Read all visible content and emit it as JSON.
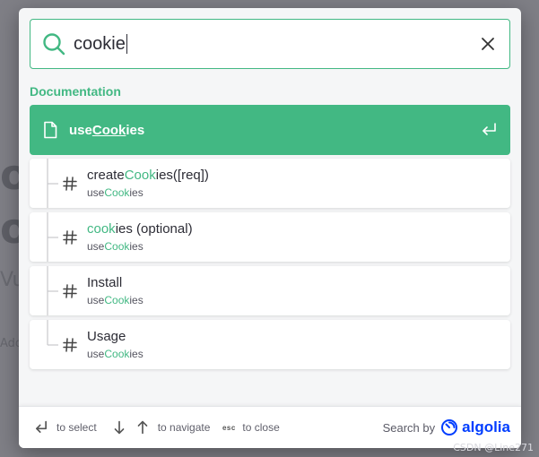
{
  "search": {
    "query": "cookie"
  },
  "section_title": "Documentation",
  "hits": {
    "main": {
      "pre": "use",
      "hl": "Cook",
      "post": "ies"
    },
    "children": [
      {
        "title_pre": "create",
        "title_hl": "Cook",
        "title_post": "ies([req])",
        "sub_pre": "use",
        "sub_hl": "Cook",
        "sub_post": "ies"
      },
      {
        "title_pre": "",
        "title_hl": "cook",
        "title_post": "ies (optional)",
        "sub_pre": "use",
        "sub_hl": "Cook",
        "sub_post": "ies"
      },
      {
        "title_pre": "Install",
        "title_hl": "",
        "title_post": "",
        "sub_pre": "use",
        "sub_hl": "Cook",
        "sub_post": "ies"
      },
      {
        "title_pre": "Usage",
        "title_hl": "",
        "title_post": "",
        "sub_pre": "use",
        "sub_hl": "Cook",
        "sub_post": "ies"
      }
    ]
  },
  "footer": {
    "select_label": "to select",
    "navigate_label": "to navigate",
    "esc_key": "esc",
    "close_label": "to close",
    "search_by": "Search by",
    "brand": "algolia"
  },
  "background": {
    "line1": "o",
    "line2": "o",
    "line3": "Vu",
    "line4": "Add"
  },
  "watermark": "CSDN @Line271",
  "colors": {
    "accent": "#42b883",
    "algolia": "#003dff"
  }
}
